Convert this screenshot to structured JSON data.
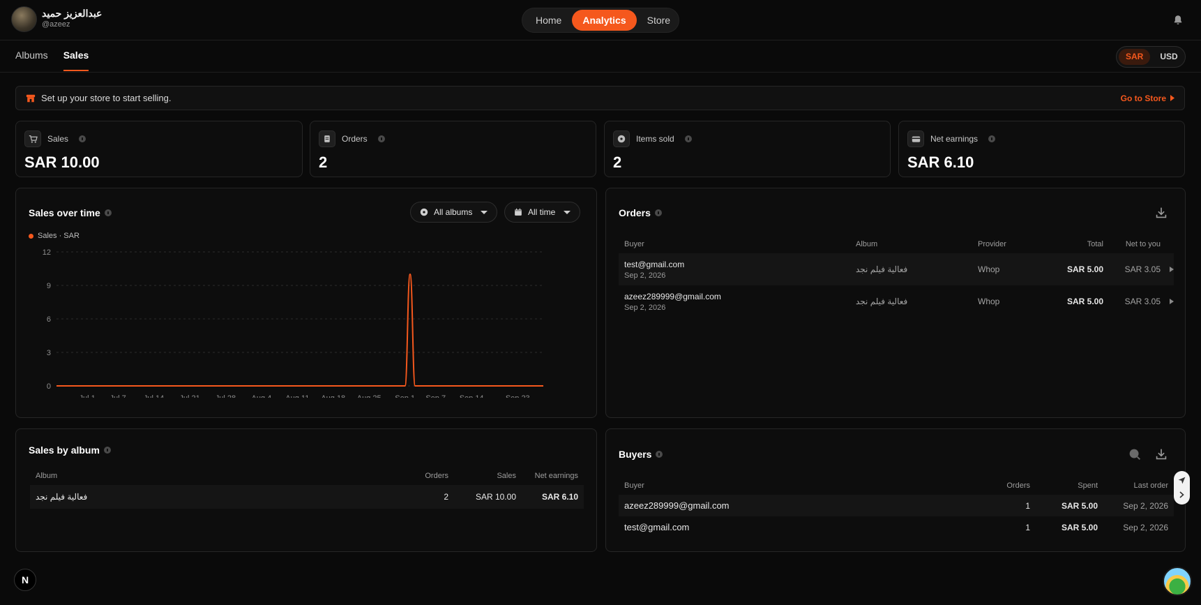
{
  "user": {
    "name": "عبدالعزيز حميد",
    "handle": "@azeez"
  },
  "nav": {
    "items": [
      "Home",
      "Analytics",
      "Store"
    ],
    "active": "Analytics"
  },
  "tabs": {
    "items": [
      "Albums",
      "Sales"
    ],
    "active": "Sales"
  },
  "currency": {
    "options": [
      "SAR",
      "USD"
    ],
    "active": "SAR"
  },
  "banner": {
    "text": "Set up your store to start selling.",
    "link": "Go to Store"
  },
  "stats": [
    {
      "label": "Sales",
      "value": "SAR 10.00",
      "icon": "cart-icon"
    },
    {
      "label": "Orders",
      "value": "2",
      "icon": "receipt-icon"
    },
    {
      "label": "Items sold",
      "value": "2",
      "icon": "disc-icon"
    },
    {
      "label": "Net earnings",
      "value": "SAR 6.10",
      "icon": "wallet-icon"
    }
  ],
  "sales_chart": {
    "title": "Sales over time",
    "album_filter": "All albums",
    "time_filter": "All time",
    "legend": "Sales · SAR"
  },
  "chart_data": {
    "type": "line",
    "series": [
      {
        "name": "Sales · SAR",
        "color": "#f5581d",
        "x": [
          "Jun 25",
          "Sep 1",
          "Sep 2",
          "Sep 3",
          "Sep 28"
        ],
        "y": [
          0,
          0,
          10,
          0,
          0
        ]
      }
    ],
    "x_tick_labels": [
      "Jul 1",
      "Jul 7",
      "Jul 14",
      "Jul 21",
      "Jul 28",
      "Aug 4",
      "Aug 11",
      "Aug 18",
      "Aug 25",
      "Sep 1",
      "Sep 7",
      "Sep 14",
      "Sep 23"
    ],
    "y_ticks": [
      0,
      3,
      6,
      9,
      12
    ],
    "ylim": [
      0,
      12
    ],
    "grid": true
  },
  "orders": {
    "title": "Orders",
    "columns": [
      "Buyer",
      "Album",
      "Provider",
      "Total",
      "Net to you"
    ],
    "rows": [
      {
        "buyer": "test@gmail.com",
        "date": "Sep 2, 2026",
        "album": "فعالية فيلم نجد",
        "provider": "Whop",
        "total": "SAR 5.00",
        "net": "SAR 3.05"
      },
      {
        "buyer": "azeez289999@gmail.com",
        "date": "Sep 2, 2026",
        "album": "فعالية فيلم نجد",
        "provider": "Whop",
        "total": "SAR 5.00",
        "net": "SAR 3.05"
      }
    ]
  },
  "sales_by_album": {
    "title": "Sales by album",
    "columns": [
      "Album",
      "Orders",
      "Sales",
      "Net earnings"
    ],
    "rows": [
      {
        "album": "فعالية فيلم نجد",
        "orders": "2",
        "sales": "SAR 10.00",
        "net": "SAR 6.10"
      }
    ]
  },
  "buyers": {
    "title": "Buyers",
    "columns": [
      "Buyer",
      "Orders",
      "Spent",
      "Last order"
    ],
    "rows": [
      {
        "buyer": "azeez289999@gmail.com",
        "orders": "1",
        "spent": "SAR 5.00",
        "last": "Sep 2, 2026"
      },
      {
        "buyer": "test@gmail.com",
        "orders": "1",
        "spent": "SAR 5.00",
        "last": "Sep 2, 2026"
      }
    ]
  },
  "badge": {
    "letter": "N"
  },
  "accent": "#f5581d"
}
